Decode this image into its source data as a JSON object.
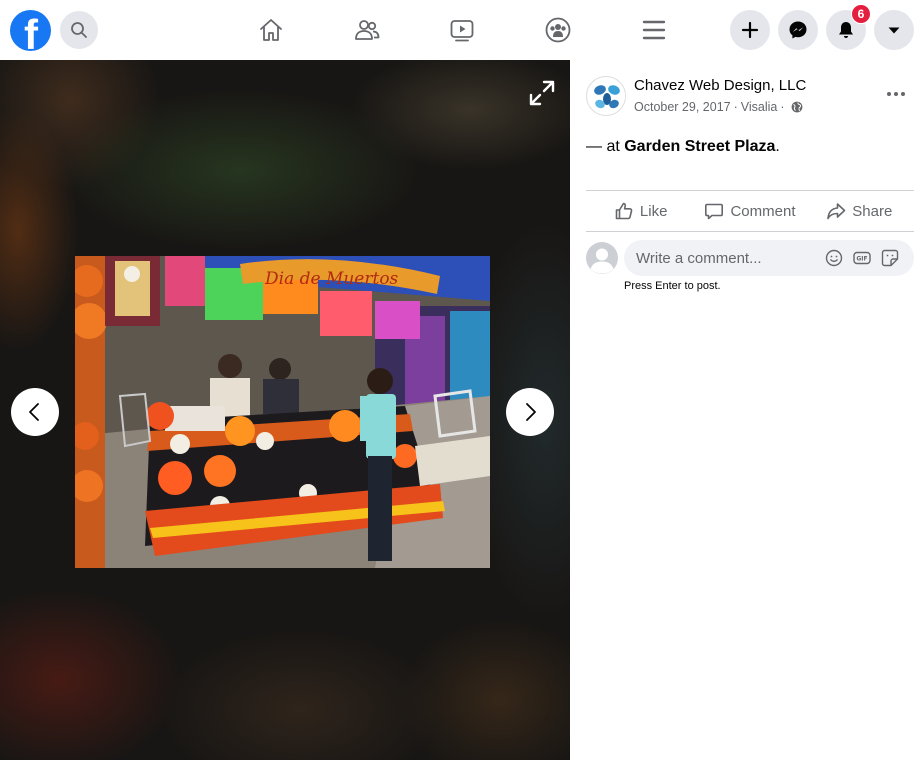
{
  "nav": {
    "notifications_count": "6",
    "brand_color": "#1877f2",
    "icons": [
      "facebook-logo",
      "search-icon",
      "home-icon",
      "friends-icon",
      "watch-icon",
      "groups-icon",
      "menu-icon",
      "create-icon",
      "messenger-icon",
      "notifications-icon",
      "account-dropdown-icon"
    ]
  },
  "viewer": {
    "photo_banner_text": "Dia de Muertos"
  },
  "post": {
    "page_name": "Chavez Web Design, LLC",
    "date": "October 29, 2017",
    "location": "Visalia",
    "separator": "·",
    "text_prefix": "— at ",
    "place": "Garden Street Plaza",
    "text_suffix": "."
  },
  "actions": {
    "like": "Like",
    "comment": "Comment",
    "share": "Share"
  },
  "comment": {
    "placeholder": "Write a comment...",
    "hint": "Press Enter to post."
  }
}
